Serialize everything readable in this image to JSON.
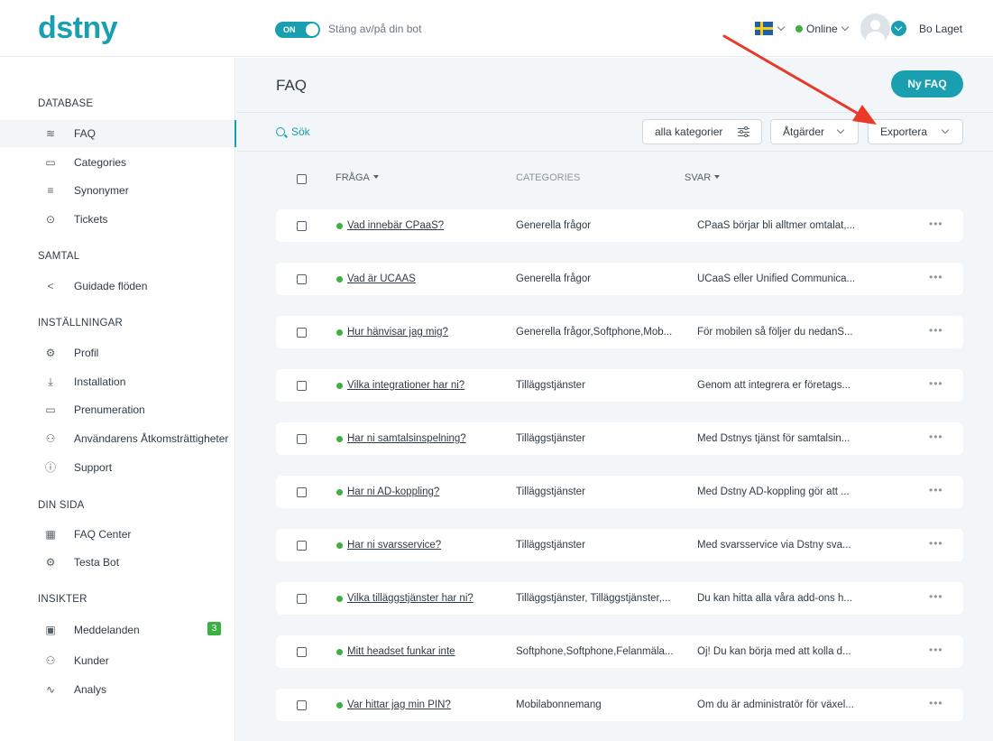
{
  "header": {
    "logo": "dstny",
    "toggle_state": "ON",
    "toggle_label": "Stäng av/på din bot",
    "language_icon": "sweden-flag-icon",
    "status": "Online",
    "status_color": "#3cb043",
    "user_name": "Bo Laget"
  },
  "sidebar": {
    "sections": [
      {
        "title": "DATABASE",
        "items": [
          {
            "label": "FAQ",
            "icon": "layers-icon",
            "active": true
          },
          {
            "label": "Categories",
            "icon": "clipboard-icon"
          },
          {
            "label": "Synonymer",
            "icon": "equals-icon"
          },
          {
            "label": "Tickets",
            "icon": "help-circle-icon"
          }
        ]
      },
      {
        "title": "SAMTAL",
        "items": [
          {
            "label": "Guidade flöden",
            "icon": "share-icon"
          }
        ]
      },
      {
        "title": "INSTÄLLNINGAR",
        "items": [
          {
            "label": "Profil",
            "icon": "gear-icon"
          },
          {
            "label": "Installation",
            "icon": "download-icon"
          },
          {
            "label": "Prenumeration",
            "icon": "clipboard-icon"
          },
          {
            "label": "Användarens Åtkomsträttigheter",
            "icon": "users-icon"
          },
          {
            "label": "Support",
            "icon": "info-icon"
          }
        ]
      },
      {
        "title": "DIN SIDA",
        "items": [
          {
            "label": "FAQ Center",
            "icon": "grid-icon"
          },
          {
            "label": "Testa Bot",
            "icon": "gears-icon"
          }
        ]
      },
      {
        "title": "INSIKTER",
        "items": [
          {
            "label": "Meddelanden",
            "icon": "chat-icon",
            "badge": "3"
          },
          {
            "label": "Kunder",
            "icon": "users-icon"
          },
          {
            "label": "Analys",
            "icon": "activity-icon"
          }
        ]
      }
    ]
  },
  "main": {
    "title": "FAQ",
    "new_button": "Ny FAQ",
    "search_placeholder": "Sök",
    "filter_label": "alla kategorier",
    "actions_label": "Åtgärder",
    "export_label": "Exportera",
    "columns": {
      "question": "FRÅGA",
      "categories": "CATEGORIES",
      "answer": "SVAR"
    },
    "rows": [
      {
        "question": "Vad innebär CPaaS?",
        "categories": "Generella frågor",
        "answer": "CPaaS börjar bli alltmer omtalat,..."
      },
      {
        "question": "Vad är UCAAS",
        "categories": "Generella frågor",
        "answer": "UCaaS eller Unified Communica..."
      },
      {
        "question": "Hur hänvisar jag mig?",
        "categories": "Generella frågor,Softphone,Mob...",
        "answer": "För mobilen så följer du nedanS..."
      },
      {
        "question": "Vilka integrationer har ni?",
        "categories": "Tilläggstjänster",
        "answer": "Genom att integrera er företags..."
      },
      {
        "question": "Har ni samtalsinspelning?",
        "categories": "Tilläggstjänster",
        "answer": "Med Dstnys tjänst för samtalsin..."
      },
      {
        "question": "Har ni AD-koppling?",
        "categories": "Tilläggstjänster",
        "answer": "Med Dstny AD-koppling gör att ..."
      },
      {
        "question": "Har ni svarsservice?",
        "categories": "Tilläggstjänster",
        "answer": "Med svarsservice via Dstny sva..."
      },
      {
        "question": "Vilka tilläggstjänster har ni?",
        "categories": "Tilläggstjänster, Tilläggstjänster,...",
        "answer": "Du kan hitta alla våra add-ons h..."
      },
      {
        "question": "Mitt headset funkar inte",
        "categories": "Softphone,Softphone,Felanmäla...",
        "answer": "Oj! Du kan börja med att kolla d..."
      },
      {
        "question": "Var hittar jag min PIN?",
        "categories": "Mobilabonnemang",
        "answer": "Om du är administratör för växel..."
      }
    ],
    "more_label": "•••"
  },
  "annotation": {
    "type": "red-arrow",
    "points_to": "export-button",
    "color": "#e8392b"
  }
}
